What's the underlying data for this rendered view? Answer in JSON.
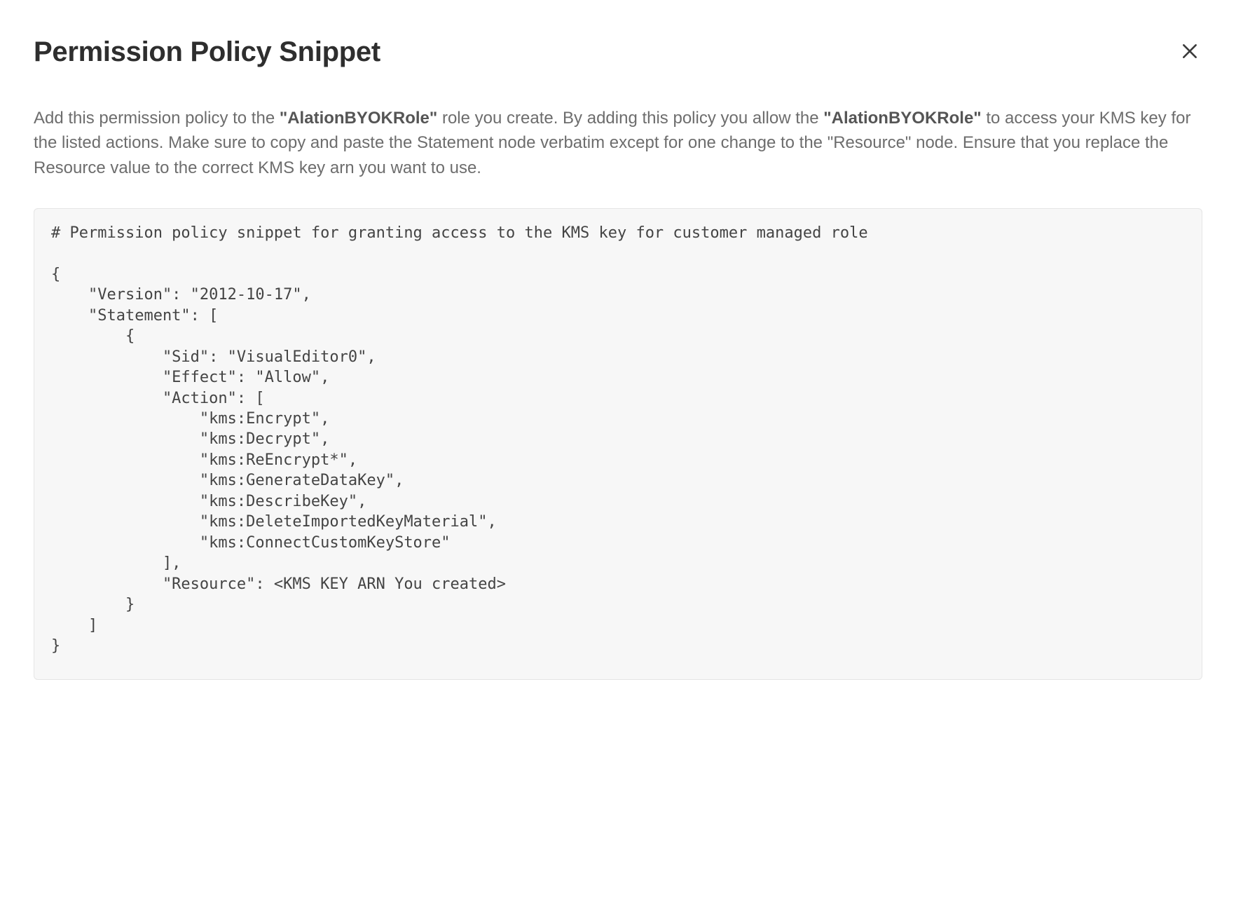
{
  "dialog": {
    "title": "Permission Policy Snippet",
    "close_icon_name": "close-icon"
  },
  "desc": {
    "p1_pre": "Add this permission policy to the ",
    "role_name": "\"AlationBYOKRole\"",
    "p1_mid": " role you create. By adding this policy you allow the ",
    "p1_after": " to access your KMS key for the listed actions. Make sure to copy and paste the Statement node verbatim except for one change to the \"Resource\" node. Ensure that you replace the Resource value to the correct KMS key arn you want to use."
  },
  "code": {
    "text": "# Permission policy snippet for granting access to the KMS key for customer managed role\n\n{\n    \"Version\": \"2012-10-17\",\n    \"Statement\": [\n        {\n            \"Sid\": \"VisualEditor0\",\n            \"Effect\": \"Allow\",\n            \"Action\": [\n                \"kms:Encrypt\",\n                \"kms:Decrypt\",\n                \"kms:ReEncrypt*\",\n                \"kms:GenerateDataKey\",\n                \"kms:DescribeKey\",\n                \"kms:DeleteImportedKeyMaterial\",\n                \"kms:ConnectCustomKeyStore\"\n            ],\n            \"Resource\": <KMS KEY ARN You created>\n        }\n    ]\n}"
  }
}
